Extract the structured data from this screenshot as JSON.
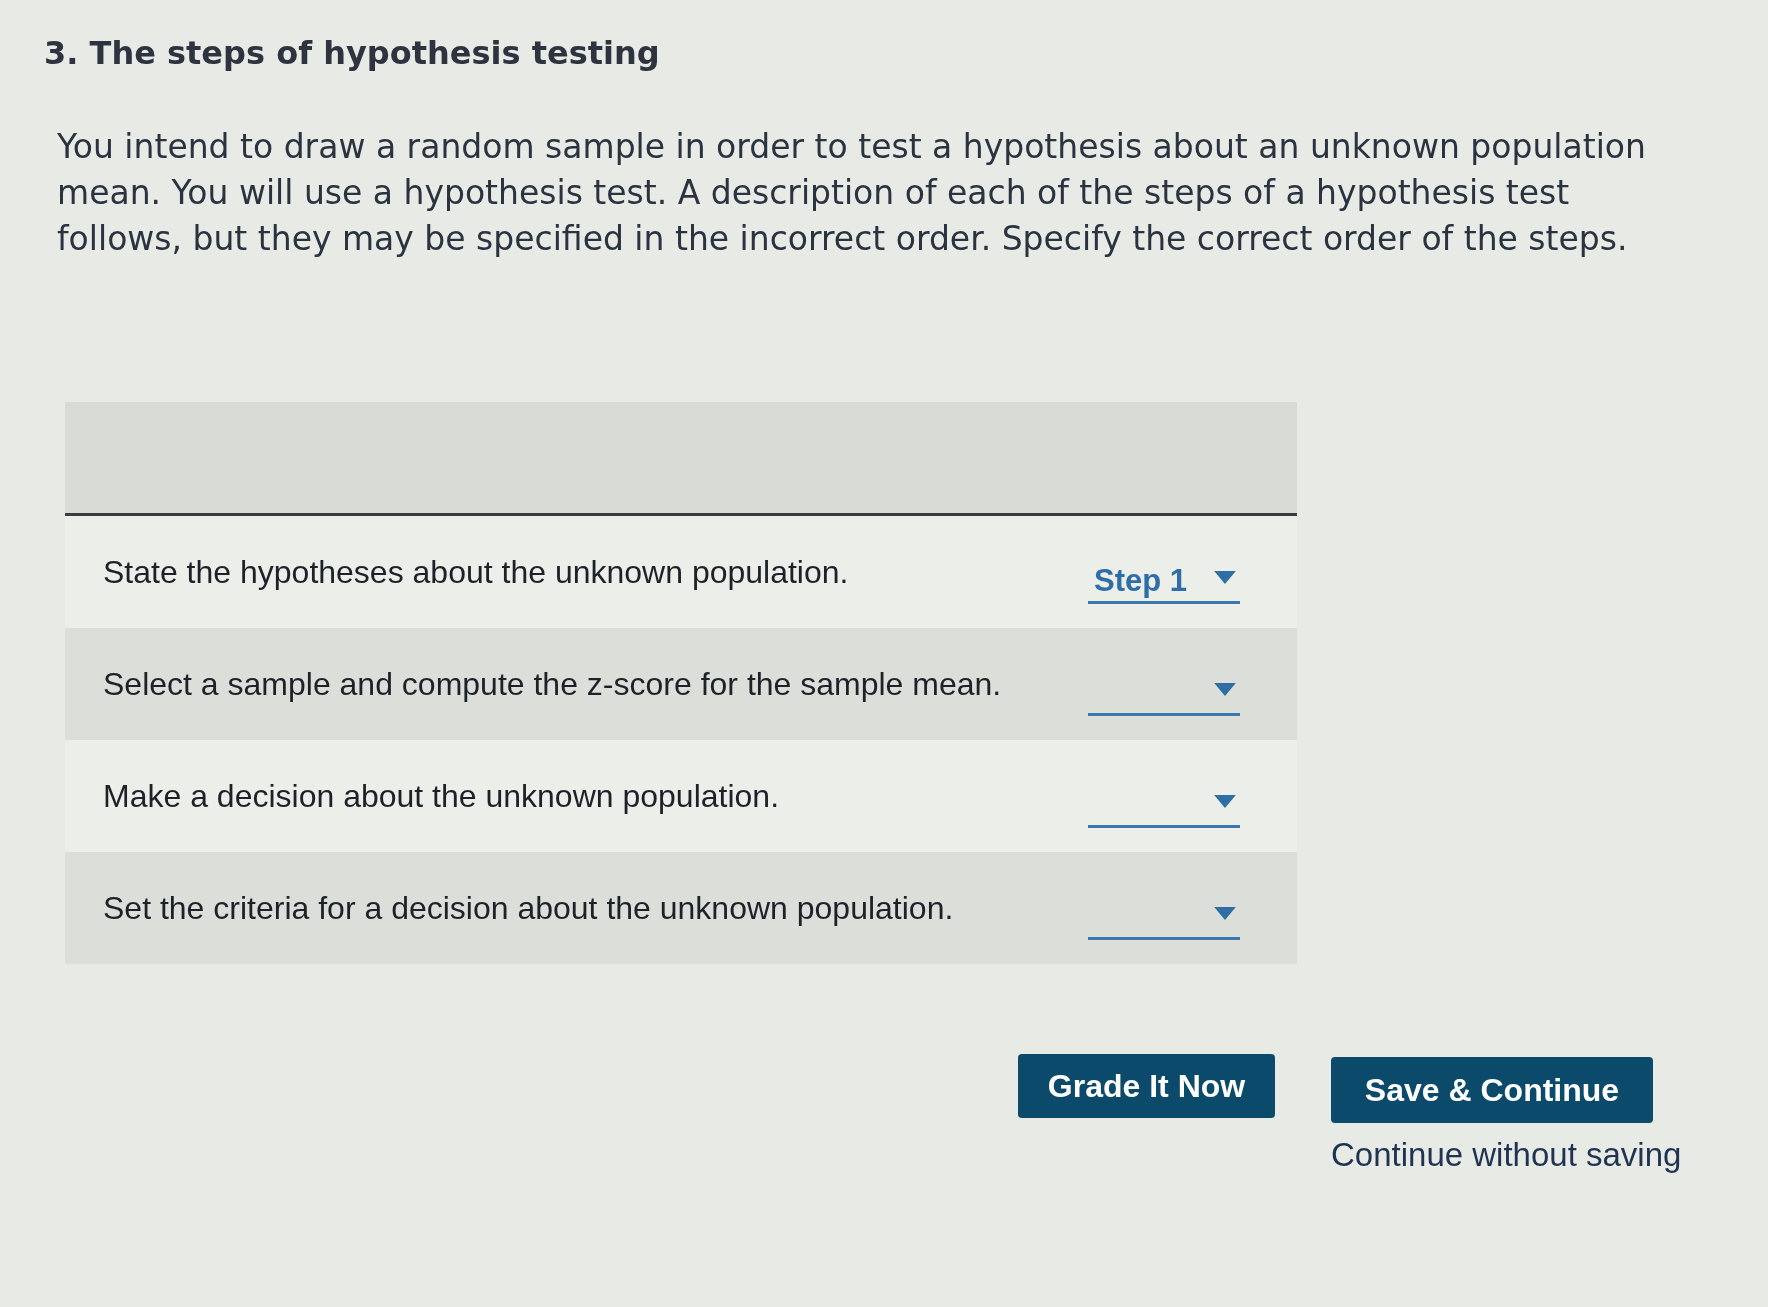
{
  "question": {
    "title": "3. The steps of hypothesis testing",
    "prompt": "You intend to draw a random sample in order to test a hypothesis about an unknown population mean. You will use a hypothesis test. A description of each of the steps of a hypothesis test follows, but they may be specified in the incorrect order. Specify the correct order of the steps."
  },
  "steps_table": {
    "rows": [
      {
        "description": "State the hypotheses about the unknown population.",
        "answer": "Step 1"
      },
      {
        "description": "Select a sample and compute the z-score for the sample mean."
      },
      {
        "description": "Make a decision about the unknown population."
      },
      {
        "description": "Set the criteria for a decision about the unknown population."
      }
    ]
  },
  "actions": {
    "buttons": [
      {
        "label": "Grade It Now"
      },
      {
        "label": "Save & Continue"
      }
    ],
    "link": "Continue without saving"
  }
}
